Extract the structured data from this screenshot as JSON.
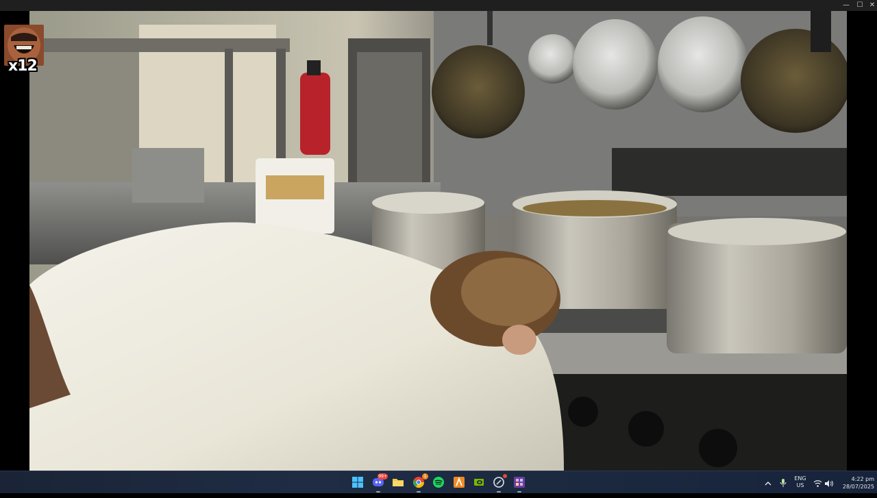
{
  "window": {
    "minimize_glyph": "—",
    "maximize_glyph": "☐",
    "close_glyph": "✕"
  },
  "video": {
    "description_icon": "video-frame",
    "overlay": {
      "count_text": "x12",
      "avatar_icon": "laughing-face-emote"
    }
  },
  "taskbar": {
    "apps": [
      {
        "name": "start",
        "icon": "windows-logo-icon",
        "color": "#4cc2ff"
      },
      {
        "name": "discord",
        "icon": "discord-icon",
        "color": "#5865f2",
        "badge": "99+"
      },
      {
        "name": "file-explorer",
        "icon": "folder-icon",
        "color": "#f4c542"
      },
      {
        "name": "chrome",
        "icon": "chrome-icon",
        "color": "#34a853",
        "badge": "1"
      },
      {
        "name": "spotify",
        "icon": "spotify-icon",
        "color": "#1ed760"
      },
      {
        "name": "app-orange",
        "icon": "a-logo-icon",
        "color": "#f08a24"
      },
      {
        "name": "nvidia",
        "icon": "nvidia-icon",
        "color": "#76b900"
      },
      {
        "name": "app-circle",
        "icon": "circle-app-icon",
        "color": "#cfd4dc",
        "badge": ""
      },
      {
        "name": "app-purple",
        "icon": "pixel-app-icon",
        "color": "#b070e0"
      }
    ],
    "tray": {
      "chevron_icon": "chevron-up-icon",
      "mic_icon": "microphone-icon",
      "lang_line1": "ENG",
      "lang_line2": "US",
      "wifi_icon": "wifi-icon",
      "volume_icon": "volume-icon",
      "time": "4:22 pm",
      "date": "28/07/2025"
    }
  }
}
